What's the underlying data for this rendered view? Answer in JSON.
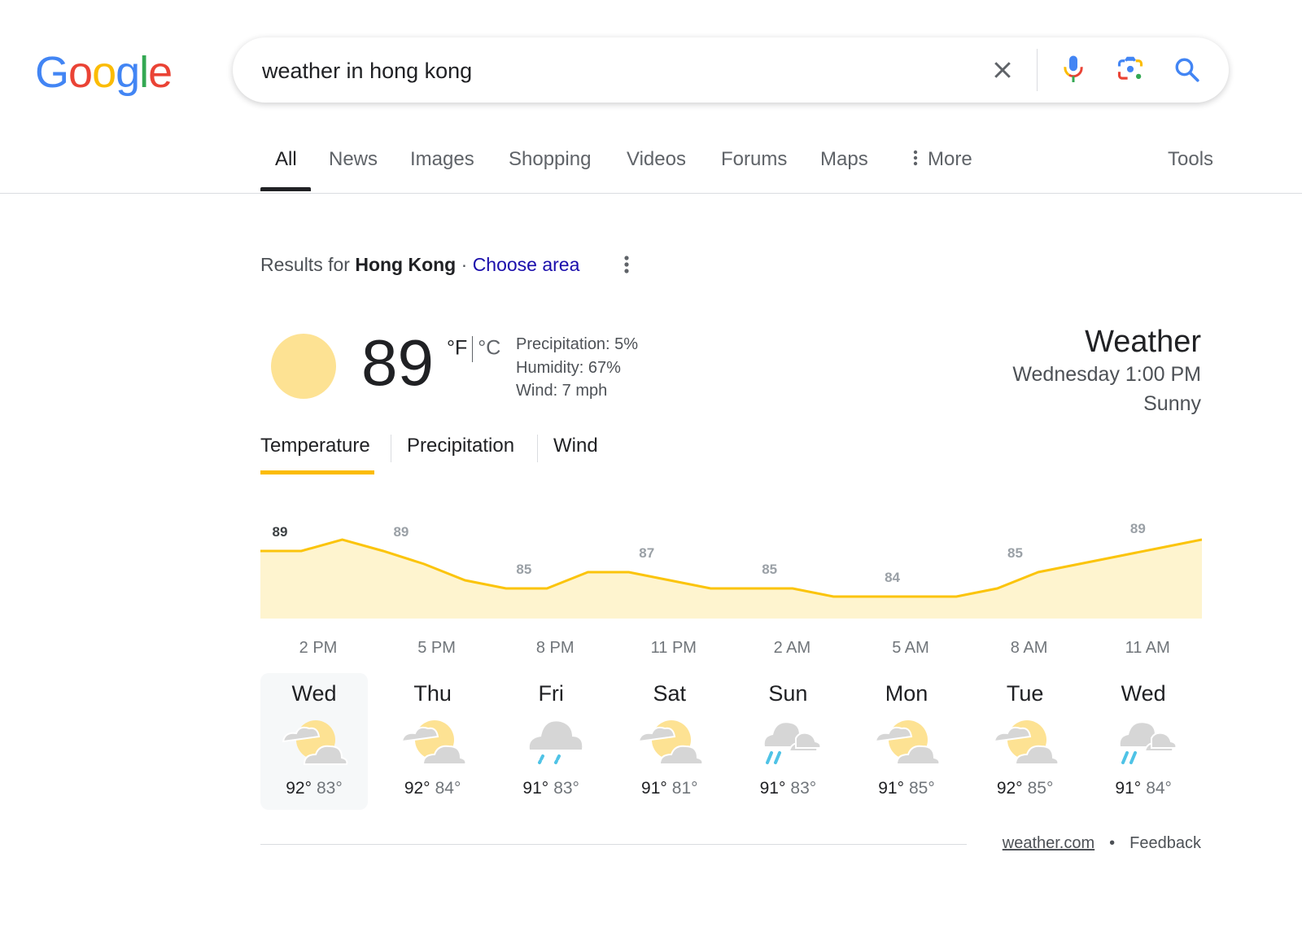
{
  "logo": {
    "text": "Google",
    "letters": [
      {
        "ch": "G",
        "color": "#4285f4"
      },
      {
        "ch": "o",
        "color": "#ea4335"
      },
      {
        "ch": "o",
        "color": "#fbbc05"
      },
      {
        "ch": "g",
        "color": "#4285f4"
      },
      {
        "ch": "l",
        "color": "#34a853"
      },
      {
        "ch": "e",
        "color": "#ea4335"
      }
    ]
  },
  "search": {
    "query": "weather in hong kong",
    "icons": [
      "close-icon",
      "voice-search-icon",
      "lens-icon",
      "search-icon"
    ]
  },
  "tabs": [
    {
      "label": "All",
      "active": true
    },
    {
      "label": "News"
    },
    {
      "label": "Images"
    },
    {
      "label": "Shopping"
    },
    {
      "label": "Videos"
    },
    {
      "label": "Forums"
    },
    {
      "label": "Maps"
    },
    {
      "label": "More"
    }
  ],
  "tools_label": "Tools",
  "results_for": {
    "prefix": "Results for",
    "place": "Hong Kong",
    "separator": "·",
    "choose_area": "Choose area"
  },
  "current": {
    "temperature": "89",
    "unit_f": "°F",
    "unit_c": "°C",
    "precipitation": "Precipitation: 5%",
    "humidity": "Humidity: 67%",
    "wind": "Wind: 7 mph",
    "icon": "sunny"
  },
  "header": {
    "title": "Weather",
    "time": "Wednesday 1:00 PM",
    "condition": "Sunny"
  },
  "subtabs": [
    {
      "label": "Temperature",
      "active": true
    },
    {
      "label": "Precipitation"
    },
    {
      "label": "Wind"
    }
  ],
  "chart_data": {
    "type": "area",
    "title": "Temperature",
    "unit": "°F",
    "x": [
      "1PM",
      "2PM",
      "3PM",
      "4PM",
      "5PM",
      "6PM",
      "7PM",
      "8PM",
      "9PM",
      "10PM",
      "11PM",
      "12AM",
      "1AM",
      "2AM",
      "3AM",
      "4AM",
      "5AM",
      "6AM",
      "7AM",
      "8AM",
      "9AM",
      "10AM",
      "11AM",
      "12PM"
    ],
    "values": [
      87.3,
      87.3,
      88,
      87.3,
      86.5,
      85.5,
      85,
      85,
      86,
      86,
      85.5,
      85,
      85,
      85,
      84.5,
      84.5,
      84.5,
      84.5,
      85,
      86,
      86.5,
      87,
      87.5,
      88
    ],
    "labels": [
      {
        "index": 0,
        "text": "89",
        "emphasis": true
      },
      {
        "index": 3,
        "text": "89"
      },
      {
        "index": 6,
        "text": "85"
      },
      {
        "index": 9,
        "text": "87"
      },
      {
        "index": 12,
        "text": "85"
      },
      {
        "index": 15,
        "text": "84"
      },
      {
        "index": 18,
        "text": "85"
      },
      {
        "index": 21,
        "text": "89"
      }
    ],
    "xticks": [
      "2 PM",
      "5 PM",
      "8 PM",
      "11 PM",
      "2 AM",
      "5 AM",
      "8 AM",
      "11 AM"
    ],
    "line_color": "#fbc40b",
    "fill_color": "#fef4cf"
  },
  "forecast": [
    {
      "day": "Wed",
      "hi": "92°",
      "lo": "83°",
      "icon": "partly-cloudy",
      "selected": true
    },
    {
      "day": "Thu",
      "hi": "92°",
      "lo": "84°",
      "icon": "partly-cloudy"
    },
    {
      "day": "Fri",
      "hi": "91°",
      "lo": "83°",
      "icon": "rain"
    },
    {
      "day": "Sat",
      "hi": "91°",
      "lo": "81°",
      "icon": "partly-cloudy"
    },
    {
      "day": "Sun",
      "hi": "91°",
      "lo": "83°",
      "icon": "scattered-showers"
    },
    {
      "day": "Mon",
      "hi": "91°",
      "lo": "85°",
      "icon": "partly-cloudy"
    },
    {
      "day": "Tue",
      "hi": "92°",
      "lo": "85°",
      "icon": "partly-cloudy"
    },
    {
      "day": "Wed",
      "hi": "91°",
      "lo": "84°",
      "icon": "scattered-showers"
    }
  ],
  "footer": {
    "source": "weather.com",
    "separator": "•",
    "feedback": "Feedback"
  }
}
